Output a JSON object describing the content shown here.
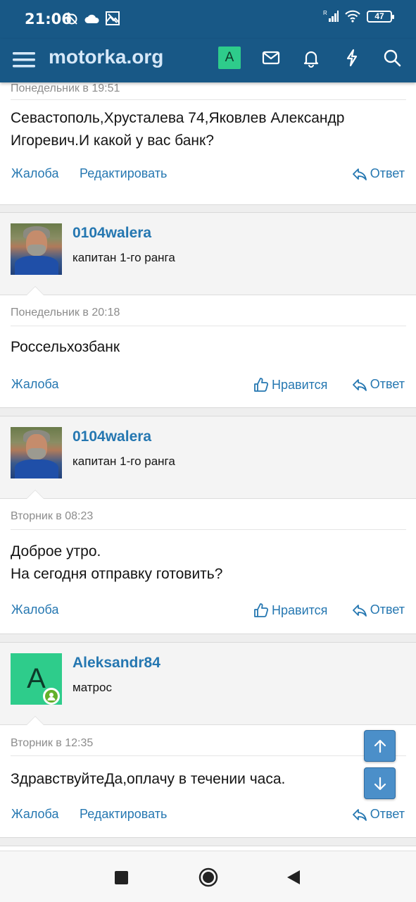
{
  "status_bar": {
    "time": "21:06",
    "battery": "47",
    "icons": [
      "alarm-off-icon",
      "cloud-icon",
      "image-icon",
      "signal-icon",
      "wifi-icon",
      "battery-icon"
    ]
  },
  "app_bar": {
    "logo": "motorka.org",
    "user_initial": "A",
    "icons": [
      "menu-icon",
      "mail-icon",
      "bell-icon",
      "lightning-icon",
      "search-icon"
    ]
  },
  "posts": [
    {
      "date": "Понедельник в 19:51",
      "text": "Севастополь,Хрусталева 74,Яковлев Александр Игоревич.И какой у вас банк?",
      "actions": {
        "report": "Жалоба",
        "edit": "Редактировать",
        "reply": "Ответ"
      }
    },
    {
      "username": "0104walera",
      "rank": "капитан 1-го ранга",
      "date": "Понедельник в 20:18",
      "text": "Россельхозбанк",
      "actions": {
        "report": "Жалоба",
        "like": "Нравится",
        "reply": "Ответ"
      }
    },
    {
      "username": "0104walera",
      "rank": "капитан 1-го ранга",
      "date": "Вторник в 08:23",
      "text_lines": [
        "Доброе утро.",
        "На сегодня отправку готовить?"
      ],
      "actions": {
        "report": "Жалоба",
        "like": "Нравится",
        "reply": "Ответ"
      }
    },
    {
      "username": "Aleksandr84",
      "avatar_letter": "A",
      "rank": "матрос",
      "date": "Вторник в 12:35",
      "text": "ЗдравствуйтеДа,оплачу в течении часа.",
      "actions": {
        "report": "Жалоба",
        "edit": "Редактировать",
        "reply": "Ответ"
      }
    }
  ],
  "colors": {
    "header": "#185886",
    "link": "#2577b1",
    "avatar_green": "#2ecc8b",
    "scroll_button": "#4b8fc9"
  }
}
